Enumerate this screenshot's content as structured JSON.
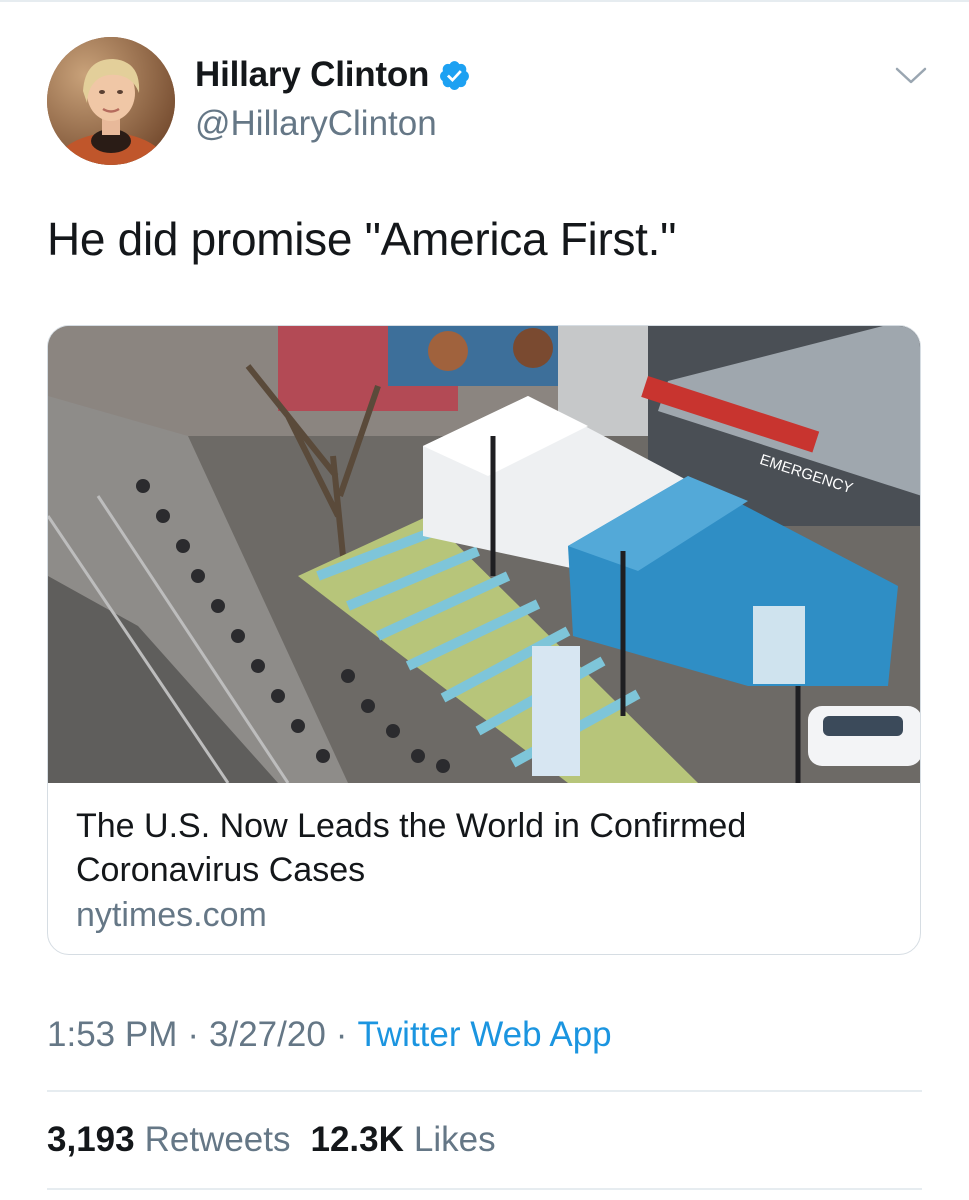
{
  "tweet": {
    "author": {
      "name": "Hillary Clinton",
      "handle": "@HillaryClinton",
      "verified": true
    },
    "text": "He did promise \"America First.\"",
    "card": {
      "title": "The U.S. Now Leads the World in Confirmed Coronavirus Cases",
      "domain": "nytimes.com",
      "photo_signage": {
        "emergency_sign": "EMERGENCY"
      }
    },
    "meta": {
      "time": "1:53 PM",
      "separator": "·",
      "date": "3/27/20",
      "source": "Twitter Web App"
    },
    "stats": {
      "retweets_count": "3,193",
      "retweets_label": "Retweets",
      "likes_count": "12.3K",
      "likes_label": "Likes"
    }
  },
  "colors": {
    "link": "#1b95e0",
    "secondary_text": "#657786",
    "verified_badge": "#1da1f2",
    "divider": "#e6ecf0"
  },
  "icons": [
    "verified-badge-icon",
    "chevron-down-icon"
  ]
}
